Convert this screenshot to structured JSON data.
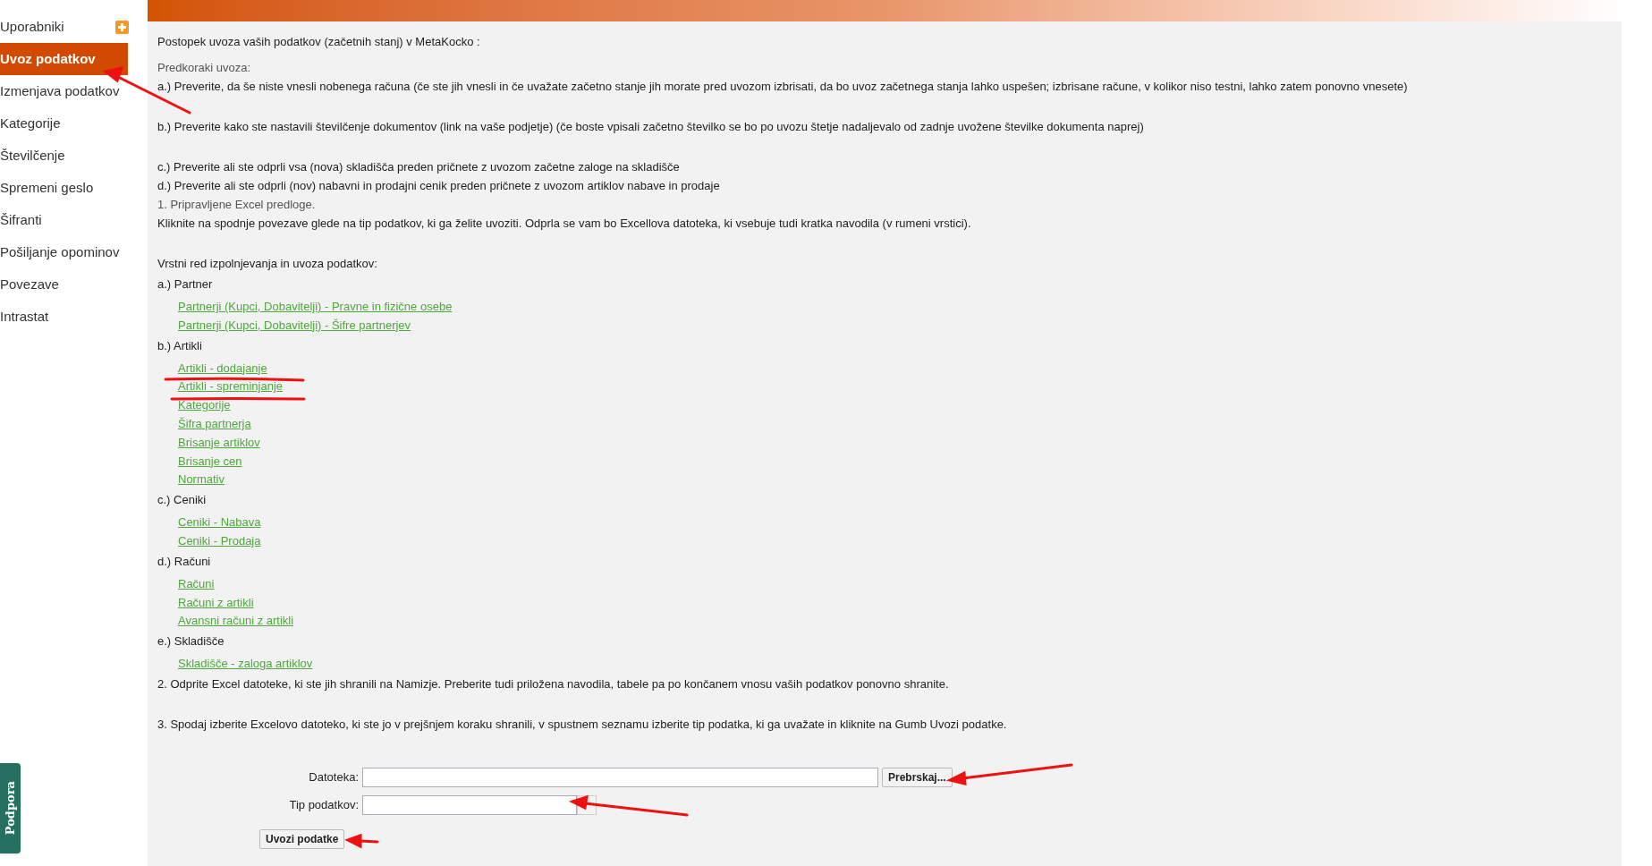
{
  "sidebar": {
    "items": [
      {
        "label": "Uporabniki",
        "selected": false,
        "has_add": true
      },
      {
        "label": "Uvoz podatkov",
        "selected": true,
        "has_add": false
      },
      {
        "label": "Izmenjava podatkov",
        "selected": false,
        "has_add": false
      },
      {
        "label": "Kategorije",
        "selected": false,
        "has_add": false
      },
      {
        "label": "Številčenje",
        "selected": false,
        "has_add": false
      },
      {
        "label": "Spremeni geslo",
        "selected": false,
        "has_add": false
      },
      {
        "label": "Šifranti",
        "selected": false,
        "has_add": false
      },
      {
        "label": "Pošiljanje opominov",
        "selected": false,
        "has_add": false
      },
      {
        "label": "Povezave",
        "selected": false,
        "has_add": false
      },
      {
        "label": "Intrastat",
        "selected": false,
        "has_add": false
      }
    ]
  },
  "support_tab": {
    "label": "Podpora"
  },
  "content": {
    "intro": "Postopek uvoza vaših podatkov (začetnih stanj) v MetaKocko :",
    "precheck_title": "Predkoraki uvoza:",
    "prechecks": [
      "a.) Preverite, da še niste vnesli nobenega računa (če ste jih vnesli in če uvažate začetno stanje jih morate pred uvozom izbrisati, da bo uvoz začetnega stanja lahko uspešen; izbrisane račune, v kolikor niso testni, lahko zatem ponovno vnesete)",
      "b.) Preverite kako ste nastavili številčenje dokumentov (link na vaše podjetje) (če boste vpisali začetno številko se bo po uvozu štetje nadaljevalo od zadnje uvožene številke dokumenta naprej)",
      "c.) Preverite ali ste odprli vsa (nova) skladišča preden pričnete z uvozom začetne zaloge na skladišče",
      "d.) Preverite ali ste odprli (nov) nabavni in prodajni cenik preden pričnete z uvozom artiklov nabave in prodaje"
    ],
    "step1_title": "1. Pripravljene Excel predloge.",
    "step1_text": "Kliknite na spodnje povezave glede na tip podatkov, ki ga želite uvoziti. Odprla se vam bo Excellova datoteka, ki vsebuje tudi kratka navodila (v rumeni vrstici).",
    "order_title": "Vrstni red izpolnjevanja in uvoza podatkov:",
    "groups": [
      {
        "title": "a.) Partner",
        "links": [
          "Partnerji (Kupci, Dobavitelji) - Pravne in fizične osebe",
          "Partnerji (Kupci, Dobavitelji) - Šifre partnerjev"
        ]
      },
      {
        "title": "b.) Artikli",
        "links": [
          "Artikli - dodajanje",
          "Artikli - spreminjanje",
          "Kategorije",
          "Šifra partnerja",
          "Brisanje artiklov",
          "Brisanje cen",
          "Normativ"
        ]
      },
      {
        "title": "c.) Ceniki",
        "links": [
          "Ceniki - Nabava",
          "Ceniki - Prodaja"
        ]
      },
      {
        "title": "d.) Računi",
        "links": [
          "Računi",
          "Računi z artikli",
          "Avansni računi z artikli"
        ]
      },
      {
        "title": "e.) Skladišče",
        "links": [
          "Skladišče - zaloga artiklov"
        ]
      }
    ],
    "step2": "2. Odprite Excel datoteke, ki ste jih shranili na Namizje. Preberite tudi priložena navodila, tabele pa po končanem vnosu vaših podatkov ponovno shranite.",
    "step3": "3. Spodaj izberite Excelovo datoteko, ki ste jo v prejšnjem koraku shranili, v spustnem seznamu izberite tip podatka, ki ga uvažate in kliknite na Gumb Uvozi podatke.",
    "form": {
      "file_label": "Datoteka:",
      "browse_button": "Prebrskaj...",
      "type_label": "Tip podatkov:",
      "submit_button": "Uvozi podatke"
    }
  }
}
